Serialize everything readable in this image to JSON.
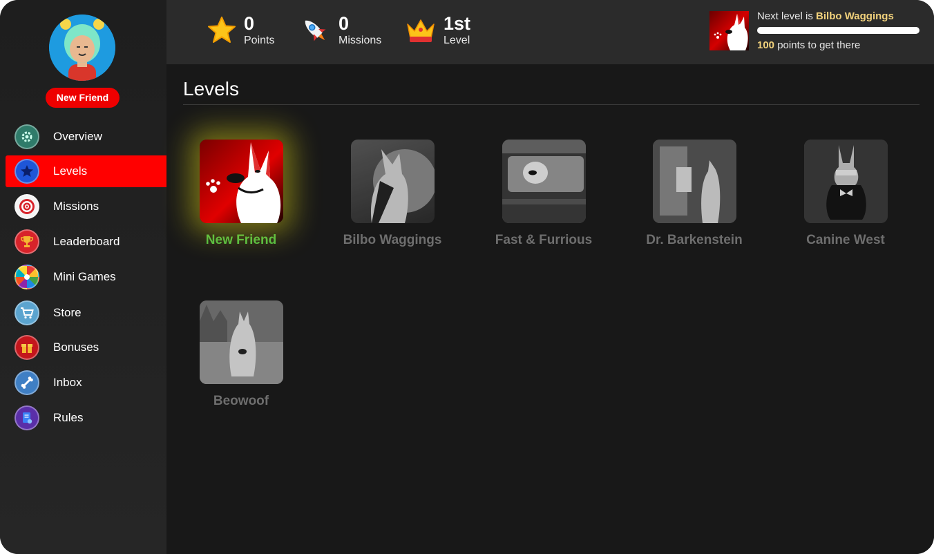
{
  "profile": {
    "badge": "New Friend"
  },
  "sidebar": {
    "items": [
      {
        "label": "Overview",
        "icon": "gear-icon",
        "active": false
      },
      {
        "label": "Levels",
        "icon": "star-icon",
        "active": true
      },
      {
        "label": "Missions",
        "icon": "target-icon",
        "active": false
      },
      {
        "label": "Leaderboard",
        "icon": "trophy-icon",
        "active": false
      },
      {
        "label": "Mini Games",
        "icon": "wheel-icon",
        "active": false
      },
      {
        "label": "Store",
        "icon": "cart-icon",
        "active": false
      },
      {
        "label": "Bonuses",
        "icon": "gift-icon",
        "active": false
      },
      {
        "label": "Inbox",
        "icon": "bone-icon",
        "active": false
      },
      {
        "label": "Rules",
        "icon": "document-icon",
        "active": false
      }
    ]
  },
  "stats": {
    "points": {
      "value": "0",
      "label": "Points"
    },
    "missions": {
      "value": "0",
      "label": "Missions"
    },
    "level": {
      "value": "1st",
      "label": "Level"
    }
  },
  "next_level": {
    "prefix": "Next level is",
    "name": "Bilbo Waggings",
    "points": "100",
    "suffix": "points to get there",
    "progress_fraction": 0
  },
  "page": {
    "title": "Levels"
  },
  "levels": [
    {
      "name": "New Friend",
      "current": true
    },
    {
      "name": "Bilbo Waggings",
      "current": false
    },
    {
      "name": "Fast & Furrious",
      "current": false
    },
    {
      "name": "Dr. Barkenstein",
      "current": false
    },
    {
      "name": "Canine West",
      "current": false
    },
    {
      "name": "Beowoof",
      "current": false
    }
  ],
  "colors": {
    "accent_red": "#ff0000",
    "highlight_gold": "#f2d27c",
    "current_level_green": "#4cbb47"
  }
}
